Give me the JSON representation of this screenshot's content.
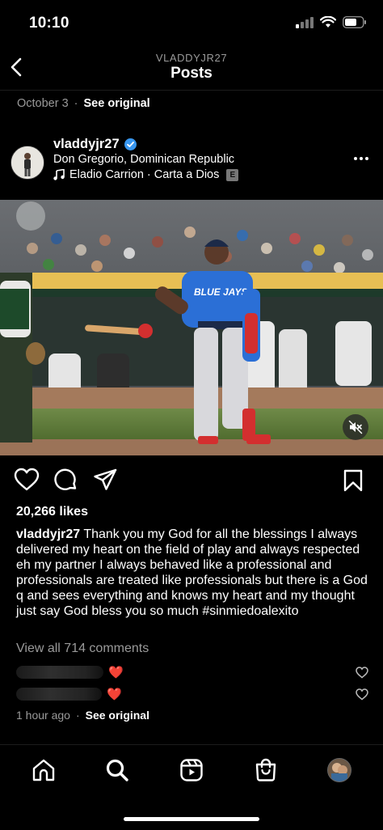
{
  "status_bar": {
    "time": "10:10"
  },
  "header": {
    "username": "VLADDYJR27",
    "title": "Posts"
  },
  "top_meta": {
    "date": "October 3",
    "separator": "·",
    "see_original": "See original"
  },
  "post": {
    "username": "vladdyjr27",
    "location": "Don Gregorio, Dominican Republic",
    "music": "Eladio Carrion · Carta a Dios",
    "explicit_badge": "E",
    "likes": "20,266 likes",
    "caption_user": "vladdyjr27",
    "caption_text": " Thank you my God for all the blessings I always delivered my heart on the field of play and always respected eh my partner I always behaved like a professional and professionals are treated like professionals but there is a God q and sees everything and knows my heart and my thought just say God bless you so much #sinmiedoalexito",
    "view_all": "View all 714 comments",
    "comments": [
      {
        "emoji": "❤️"
      },
      {
        "emoji": "❤️"
      }
    ],
    "time_ago": "1 hour ago",
    "separator": "·",
    "see_original": "See original"
  },
  "colors": {
    "background": "#000000",
    "secondary_text": "#9a9a9a",
    "verified": "#3897f0",
    "jersey": "#2b6fd6"
  },
  "icons": [
    "back-arrow-icon",
    "verified-icon",
    "music-note-icon",
    "more-icon",
    "mute-icon",
    "heart-icon",
    "comment-icon",
    "share-icon",
    "bookmark-icon",
    "home-icon",
    "search-icon",
    "reels-icon",
    "shop-icon"
  ]
}
